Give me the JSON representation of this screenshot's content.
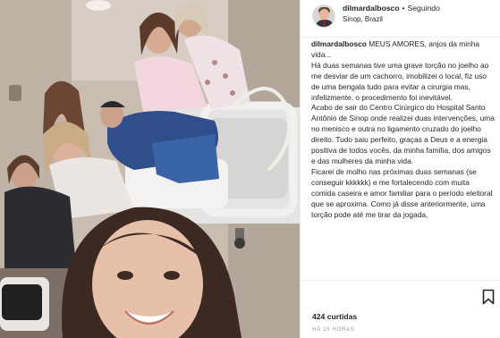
{
  "post": {
    "photo_alt": "foto",
    "author": {
      "username": "dilmardalbosco",
      "separator": "•",
      "follow_label": "Seguindo",
      "location": "Sinop, Brazil"
    },
    "caption": {
      "username": "dilmardalbosco",
      "lines": [
        "MEUS AMORES, anjos da minha vida...",
        "Há duas semanas tive uma grave torção no joelho ao me desviar de um cachorro, imobilizei o local, fiz uso de uma bengala tudo para evitar a cirurgia mas, infelizmente, o procedimento foi inevitável.",
        "Acabo de sair do Centro Cirúrgico do Hospital Santo Antônio de Sinop onde realizei duas intervenções, uma no menisco e outra no ligamento cruzado do joelho direito. Tudo saiu perfeito, graças a Deus e a energia positiva de todos vocês, da minha família, dos amigos e das mulheres da minha vida.",
        "Ficarei de molho nas próximas duas semanas (se conseguir kkkkkk) e me fortalecendo com muita comida caseira e amor familiar para o período eleitoral que se aproxima. Como já disse anteriormente, uma torção pode até me tirar da jogada,"
      ]
    },
    "likes_text": "424 curtidas",
    "time_text": "HÁ 15 HORAS",
    "icons": {
      "bookmark": "bookmark-icon"
    }
  }
}
